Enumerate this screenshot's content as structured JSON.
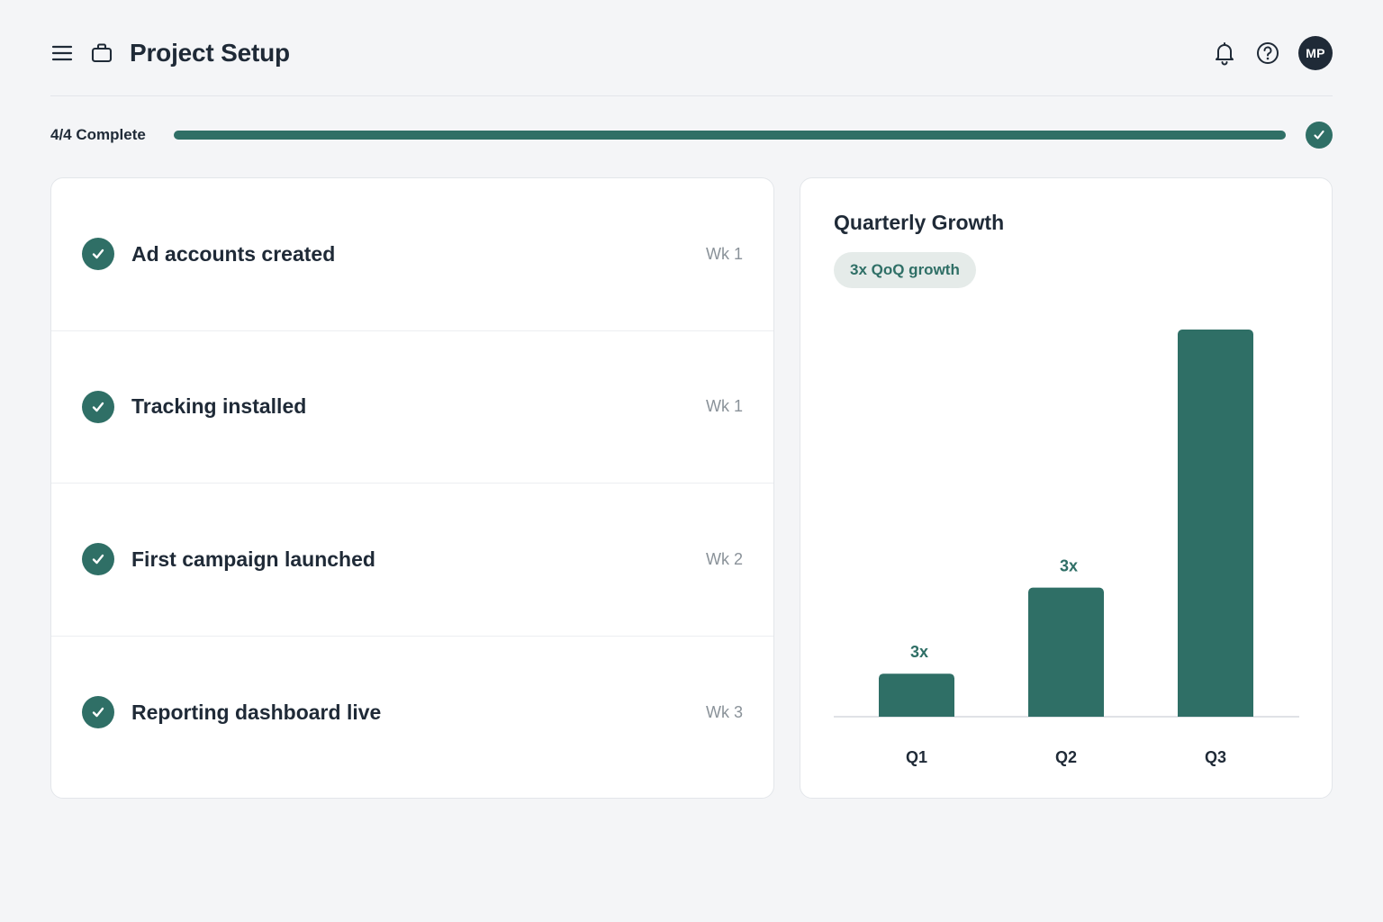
{
  "header": {
    "title": "Project Setup",
    "avatar_initials": "MP",
    "icons": [
      "menu-icon",
      "briefcase-icon",
      "bell-icon",
      "help-icon"
    ]
  },
  "progress": {
    "label": "4/4 Complete",
    "completed": 4,
    "total": 4,
    "fraction": 1.0
  },
  "tasks": [
    {
      "label": "Ad accounts created",
      "week": "Wk 1",
      "done": true
    },
    {
      "label": "Tracking installed",
      "week": "Wk 1",
      "done": true
    },
    {
      "label": "First campaign launched",
      "week": "Wk 2",
      "done": true
    },
    {
      "label": "Reporting dashboard live",
      "week": "Wk 3",
      "done": true
    }
  ],
  "chart": {
    "title": "Quarterly Growth",
    "pill": "3x QoQ growth"
  },
  "colors": {
    "accent": "#2f6f66",
    "text": "#1f2a37",
    "muted": "#8a9299",
    "background": "#f4f5f7"
  },
  "chart_data": {
    "type": "bar",
    "title": "Quarterly Growth",
    "categories": [
      "Q1",
      "Q2",
      "Q3"
    ],
    "values": [
      1,
      3,
      9
    ],
    "data_labels": [
      "3x",
      "3x",
      ""
    ],
    "xlabel": "",
    "ylabel": "",
    "ylim": [
      0,
      9
    ],
    "grid": false
  }
}
